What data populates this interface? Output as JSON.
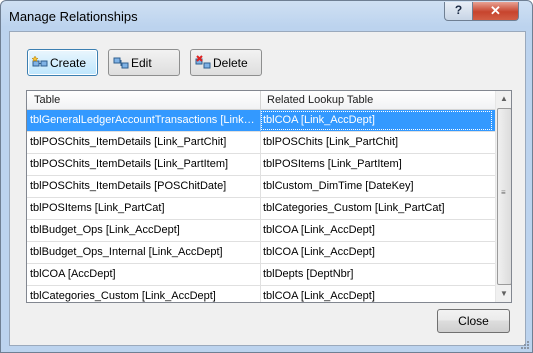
{
  "window": {
    "title": "Manage Relationships"
  },
  "titlebar": {
    "help_glyph": "?",
    "close_glyph": "✕"
  },
  "toolbar": {
    "create_label": "Create",
    "edit_label": "Edit",
    "delete_label": "Delete"
  },
  "grid": {
    "columns": [
      "Table",
      "Related Lookup Table"
    ],
    "rows": [
      {
        "table": "tblGeneralLedgerAccountTransactions [Link_AccDept]",
        "lookup": "tblCOA [Link_AccDept]",
        "selected": true
      },
      {
        "table": "tblPOSChits_ItemDetails [Link_PartChit]",
        "lookup": "tblPOSChits [Link_PartChit]"
      },
      {
        "table": "tblPOSChits_ItemDetails [Link_PartItem]",
        "lookup": "tblPOSItems [Link_PartItem]"
      },
      {
        "table": "tblPOSChits_ItemDetails [POSChitDate]",
        "lookup": "tblCustom_DimTime [DateKey]"
      },
      {
        "table": "tblPOSItems [Link_PartCat]",
        "lookup": "tblCategories_Custom [Link_PartCat]"
      },
      {
        "table": "tblBudget_Ops [Link_AccDept]",
        "lookup": "tblCOA [Link_AccDept]"
      },
      {
        "table": "tblBudget_Ops_Internal [Link_AccDept]",
        "lookup": "tblCOA [Link_AccDept]"
      },
      {
        "table": "tblCOA [AccDept]",
        "lookup": "tblDepts [DeptNbr]"
      },
      {
        "table": "tblCategories_Custom [Link_AccDept]",
        "lookup": "tblCOA [Link_AccDept]"
      }
    ]
  },
  "footer": {
    "close_label": "Close"
  },
  "colors": {
    "selection": "#3399ff",
    "frame": "#bcd3ee"
  }
}
